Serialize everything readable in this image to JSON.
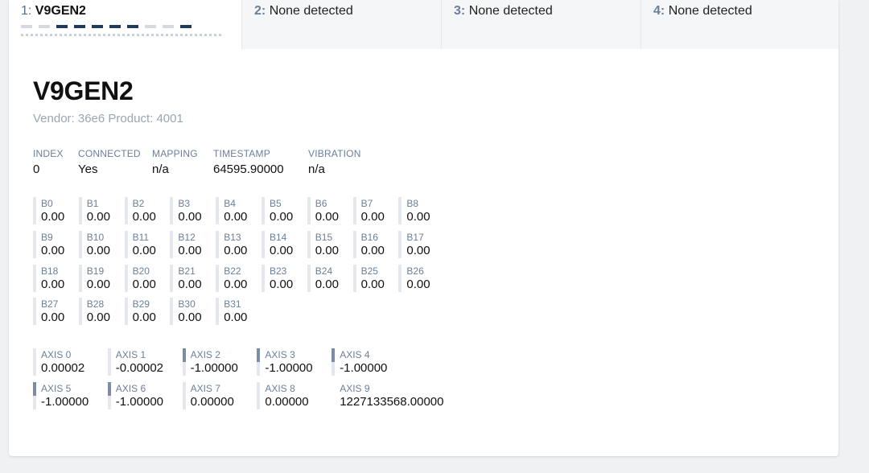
{
  "tabs": [
    {
      "num": "1:",
      "name": "V9GEN2"
    },
    {
      "num": "2:",
      "name": "None detected"
    },
    {
      "num": "3:",
      "name": "None detected"
    },
    {
      "num": "4:",
      "name": "None detected"
    }
  ],
  "device": {
    "name": "V9GEN2",
    "vendor": "Vendor: 36e6 Product: 4001"
  },
  "info": {
    "index_label": "INDEX",
    "index": "0",
    "connected_label": "CONNECTED",
    "connected": "Yes",
    "mapping_label": "MAPPING",
    "mapping": "n/a",
    "timestamp_label": "TIMESTAMP",
    "timestamp": "64595.90000",
    "vibration_label": "VIBRATION",
    "vibration": "n/a"
  },
  "buttons": [
    {
      "label": "B0",
      "value": "0.00"
    },
    {
      "label": "B1",
      "value": "0.00"
    },
    {
      "label": "B2",
      "value": "0.00"
    },
    {
      "label": "B3",
      "value": "0.00"
    },
    {
      "label": "B4",
      "value": "0.00"
    },
    {
      "label": "B5",
      "value": "0.00"
    },
    {
      "label": "B6",
      "value": "0.00"
    },
    {
      "label": "B7",
      "value": "0.00"
    },
    {
      "label": "B8",
      "value": "0.00"
    },
    {
      "label": "B9",
      "value": "0.00"
    },
    {
      "label": "B10",
      "value": "0.00"
    },
    {
      "label": "B11",
      "value": "0.00"
    },
    {
      "label": "B12",
      "value": "0.00"
    },
    {
      "label": "B13",
      "value": "0.00"
    },
    {
      "label": "B14",
      "value": "0.00"
    },
    {
      "label": "B15",
      "value": "0.00"
    },
    {
      "label": "B16",
      "value": "0.00"
    },
    {
      "label": "B17",
      "value": "0.00"
    },
    {
      "label": "B18",
      "value": "0.00"
    },
    {
      "label": "B19",
      "value": "0.00"
    },
    {
      "label": "B20",
      "value": "0.00"
    },
    {
      "label": "B21",
      "value": "0.00"
    },
    {
      "label": "B22",
      "value": "0.00"
    },
    {
      "label": "B23",
      "value": "0.00"
    },
    {
      "label": "B24",
      "value": "0.00"
    },
    {
      "label": "B25",
      "value": "0.00"
    },
    {
      "label": "B26",
      "value": "0.00"
    },
    {
      "label": "B27",
      "value": "0.00"
    },
    {
      "label": "B28",
      "value": "0.00"
    },
    {
      "label": "B29",
      "value": "0.00"
    },
    {
      "label": "B30",
      "value": "0.00"
    },
    {
      "label": "B31",
      "value": "0.00"
    }
  ],
  "axes": [
    {
      "label": "AXIS 0",
      "value": "0.00002",
      "level": 2e-05
    },
    {
      "label": "AXIS 1",
      "value": "-0.00002",
      "level": -2e-05
    },
    {
      "label": "AXIS 2",
      "value": "-1.00000",
      "level": -1
    },
    {
      "label": "AXIS 3",
      "value": "-1.00000",
      "level": -1
    },
    {
      "label": "AXIS 4",
      "value": "-1.00000",
      "level": -1
    },
    {
      "label": "AXIS 5",
      "value": "-1.00000",
      "level": -1
    },
    {
      "label": "AXIS 6",
      "value": "-1.00000",
      "level": -1
    },
    {
      "label": "AXIS 7",
      "value": "0.00000",
      "level": 0
    },
    {
      "label": "AXIS 8",
      "value": "0.00000",
      "level": 0
    },
    {
      "label": "AXIS 9",
      "value": "1227133568.00000",
      "level": null
    }
  ],
  "colors": {
    "accent": "#1f3a5c",
    "bar_light": "#d5dae0",
    "axis_mark": "#7a8ca6"
  }
}
